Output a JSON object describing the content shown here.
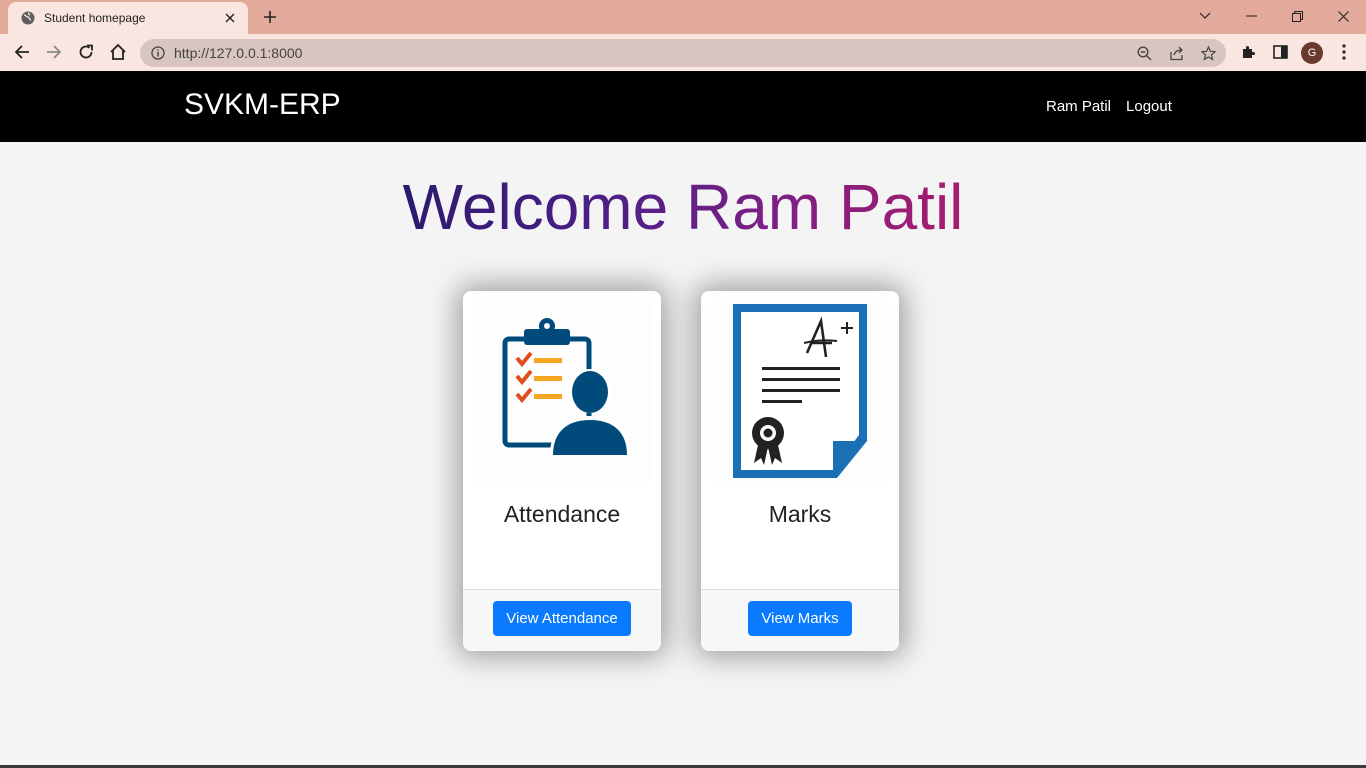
{
  "browser": {
    "tab_title": "Student homepage",
    "url": "http://127.0.0.1:8000",
    "profile_initial": "G",
    "icons": [
      "globe-icon",
      "close-icon",
      "plus-icon",
      "chevron-down-icon",
      "minimize-icon",
      "restore-icon",
      "close-window-icon",
      "back-arrow-icon",
      "forward-arrow-icon",
      "reload-icon",
      "home-icon",
      "info-icon",
      "zoom-icon",
      "share-icon",
      "star-icon",
      "extensions-icon",
      "sidepanel-icon",
      "menu-icon"
    ],
    "colors": {
      "tabstrip": "#e4aa9b",
      "toolbar": "#f9e6e1"
    }
  },
  "site": {
    "brand": "SVKM-ERP",
    "nav": {
      "user": "Ram Patil",
      "logout": "Logout"
    },
    "welcome": "Welcome Ram Patil",
    "cards": [
      {
        "title": "Attendance",
        "button": "View Attendance",
        "icon": "attendance-clipboard-icon"
      },
      {
        "title": "Marks",
        "button": "View Marks",
        "icon": "marks-certificate-icon"
      }
    ],
    "colors": {
      "navbar": "#000000",
      "button": "#0a7bff",
      "background": "#f4f4f4"
    }
  }
}
